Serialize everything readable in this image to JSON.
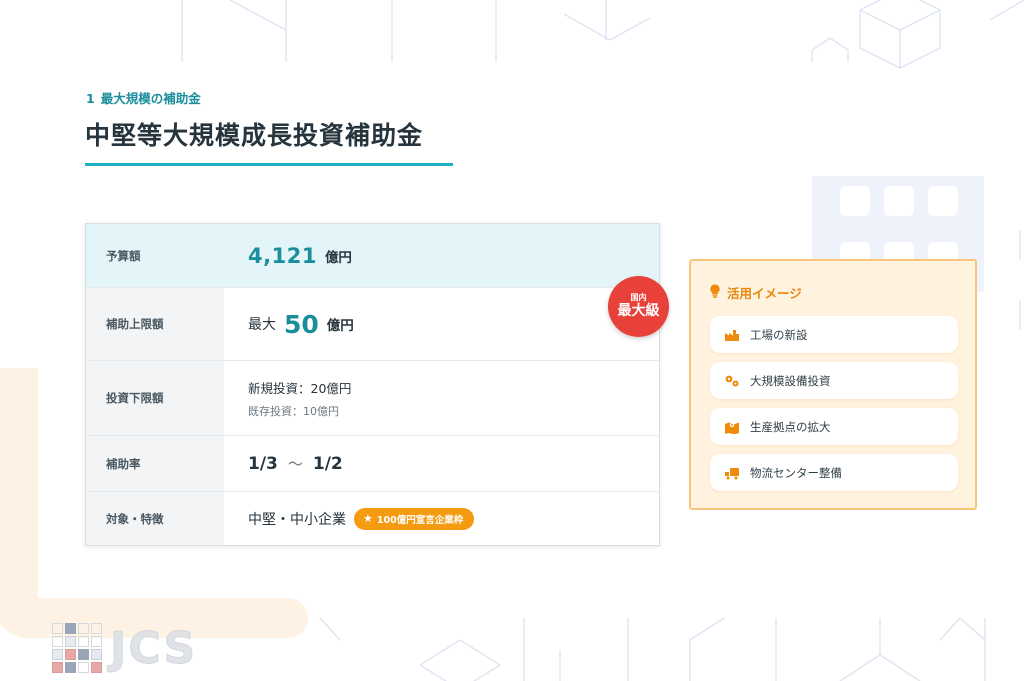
{
  "header": {
    "section_number": "1",
    "section_label": "最大規模の補助金",
    "title": "中堅等大規模成長投資補助金"
  },
  "table": {
    "budget": {
      "label": "予算額",
      "amount": "4,121",
      "unit": "億円"
    },
    "subsidy_cap": {
      "label": "補助上限額",
      "prefix": "最大",
      "amount": "50",
      "unit": "億円"
    },
    "min_investment": {
      "label": "投資下限額",
      "new": "新規投資：20億円",
      "existing": "既存投資：10億円"
    },
    "subsidy_rate": {
      "label": "補助率",
      "from": "1/3",
      "tilde": "～",
      "to": "1/2"
    },
    "target": {
      "label": "対象・特徴",
      "value": "中堅・中小企業",
      "tag": "100億円宣言企業枠"
    }
  },
  "badge": {
    "small": "国内",
    "large": "最大級"
  },
  "usage": {
    "heading": "活用イメージ",
    "items": [
      {
        "label": "工場の新設",
        "icon": "factory-icon"
      },
      {
        "label": "大規模設備投資",
        "icon": "gears-icon"
      },
      {
        "label": "生産拠点の拡大",
        "icon": "location-map-icon"
      },
      {
        "label": "物流センター整備",
        "icon": "delivery-truck-icon"
      }
    ]
  },
  "logo": {
    "text": "JCS"
  },
  "colors": {
    "accent_teal": "#1b8e9c",
    "underline": "#1fb0c6",
    "budget_row_bg": "#e3f5f8",
    "badge_red": "#e8413a",
    "tag_orange": "#f49b12",
    "usage_bg": "#fff3df",
    "usage_border": "#f7c67a"
  }
}
